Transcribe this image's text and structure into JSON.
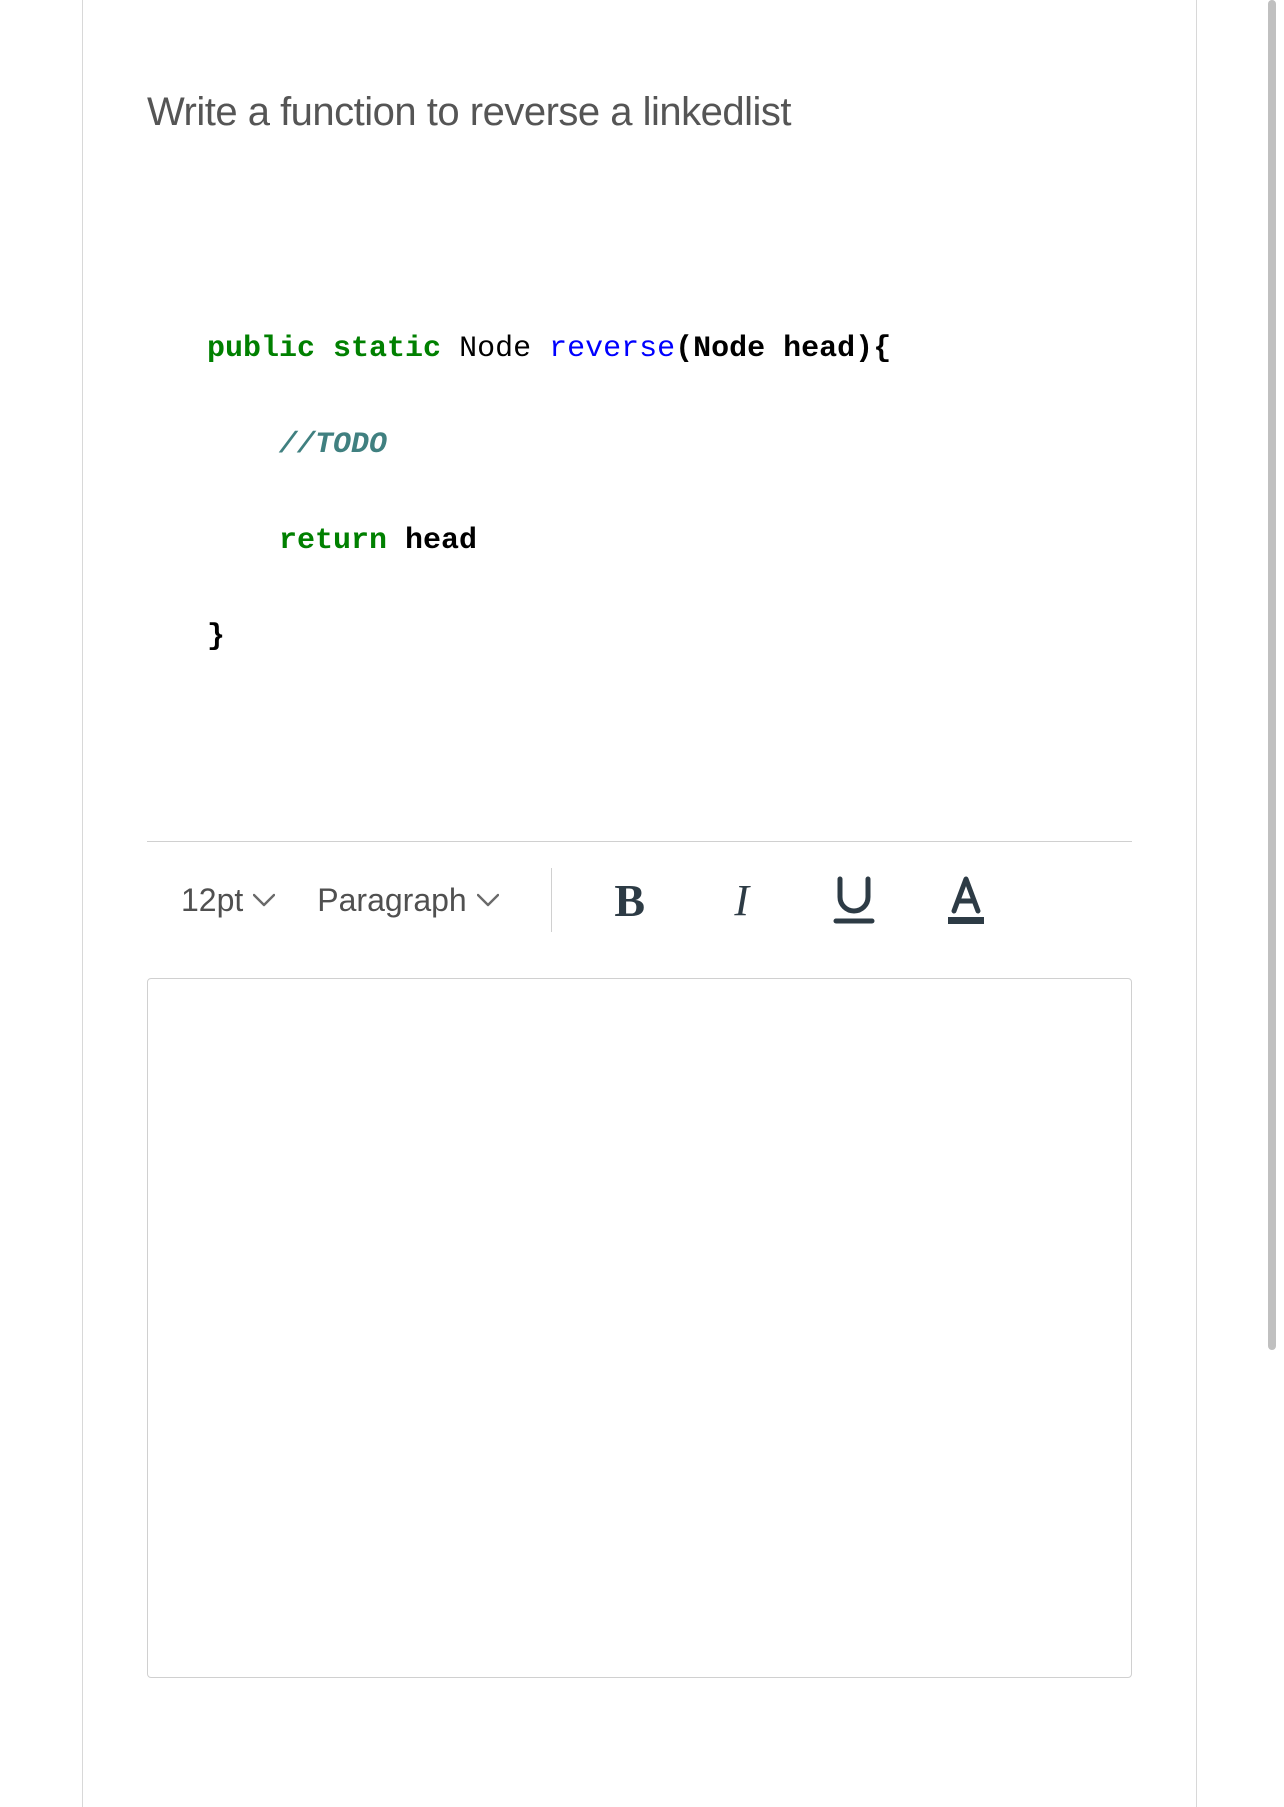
{
  "question": {
    "title": "Write a function to reverse a linkedlist"
  },
  "code": {
    "public": "public",
    "static": "static",
    "type_node": "Node",
    "fn_name": "reverse",
    "sig_tail": "(Node head){",
    "comment": "//TODO",
    "return_kw": "return",
    "return_val": " head",
    "close_brace": "}"
  },
  "toolbar": {
    "font_size": "12pt",
    "block_type": "Paragraph",
    "bold_label": "B",
    "italic_label": "I"
  },
  "editor": {
    "content": ""
  }
}
